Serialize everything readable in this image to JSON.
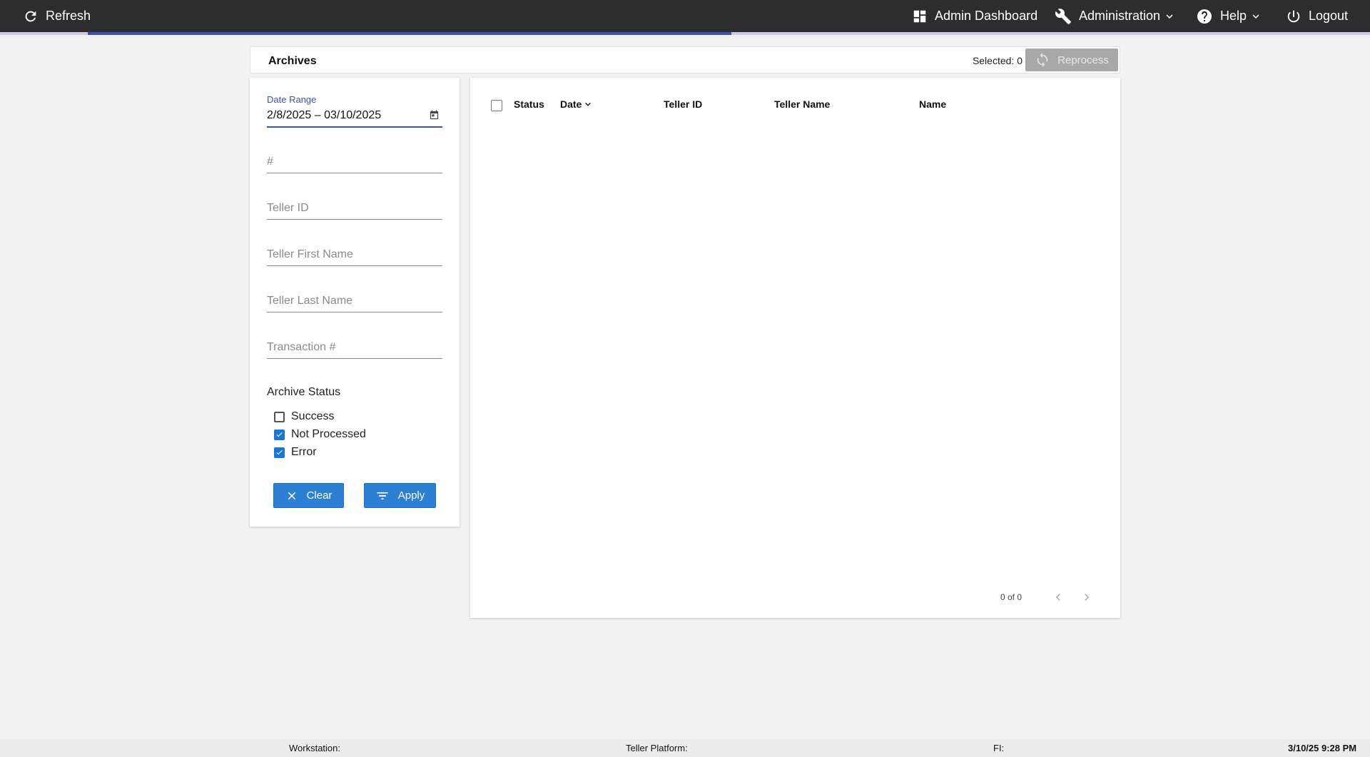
{
  "topbar": {
    "refresh_label": "Refresh",
    "admin_dashboard_label": "Admin Dashboard",
    "administration_label": "Administration",
    "help_label": "Help",
    "logout_label": "Logout",
    "load_progress_percent": 47
  },
  "archives": {
    "title": "Archives",
    "selected_text": "Selected: 0",
    "reprocess_label": "Reprocess"
  },
  "filters": {
    "date_range_label": "Date Range",
    "date_range_value": "2/8/2025 – 03/10/2025",
    "number_placeholder": "#",
    "teller_id_placeholder": "Teller ID",
    "teller_first_name_placeholder": "Teller First Name",
    "teller_last_name_placeholder": "Teller Last Name",
    "transaction_placeholder": "Transaction #",
    "archive_status_title": "Archive Status",
    "statuses": [
      {
        "label": "Success",
        "checked": false
      },
      {
        "label": "Not Processed",
        "checked": true
      },
      {
        "label": "Error",
        "checked": true
      }
    ],
    "clear_label": "Clear",
    "apply_label": "Apply"
  },
  "grid": {
    "columns": [
      "Status",
      "Date",
      "Teller ID",
      "Teller Name",
      "Name"
    ],
    "sort_column": "Date",
    "pager_text": "0 of 0"
  },
  "footer": {
    "workstation": "Workstation:",
    "teller_platform": "Teller Platform:",
    "fi": "FI:",
    "datetime": "3/10/25 9:28 PM"
  },
  "colors": {
    "topbar": "#2d2d2d",
    "accent": "#3f51b5",
    "button_blue": "#2d7fd4",
    "disabled_button": "#a8a8a8"
  }
}
